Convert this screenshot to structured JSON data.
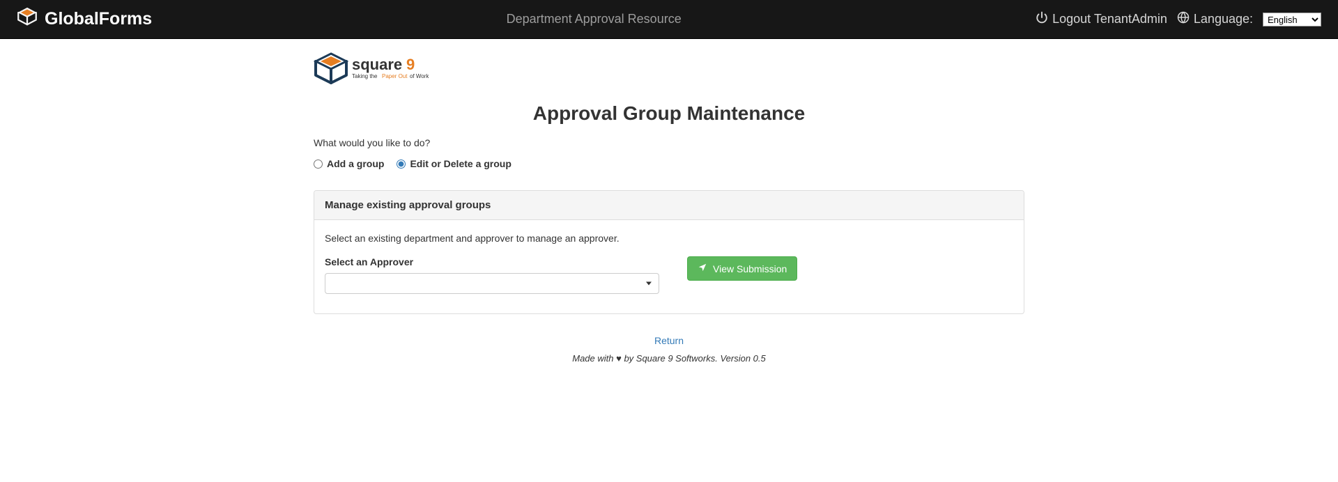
{
  "navbar": {
    "brand": "GlobalForms",
    "center_title": "Department Approval Resource",
    "logout_label": "Logout TenantAdmin",
    "language_label": "Language:",
    "language_selected": "English",
    "language_options": [
      "English"
    ]
  },
  "logo": {
    "name": "square9",
    "tagline_prefix": "Taking the ",
    "tagline_highlight": "Paper Out",
    "tagline_suffix": " of Work"
  },
  "main": {
    "title": "Approval Group Maintenance",
    "prompt": "What would you like to do?",
    "radios": {
      "add": "Add a group",
      "edit": "Edit or Delete a group",
      "selected": "edit"
    },
    "panel": {
      "heading": "Manage existing approval groups",
      "help": "Select an existing department and approver to manage an approver.",
      "approver_label": "Select an Approver",
      "approver_value": "",
      "view_submission_label": "View Submission"
    },
    "return_label": "Return",
    "footer": "Made with ♥ by Square 9 Softworks. Version 0.5"
  }
}
